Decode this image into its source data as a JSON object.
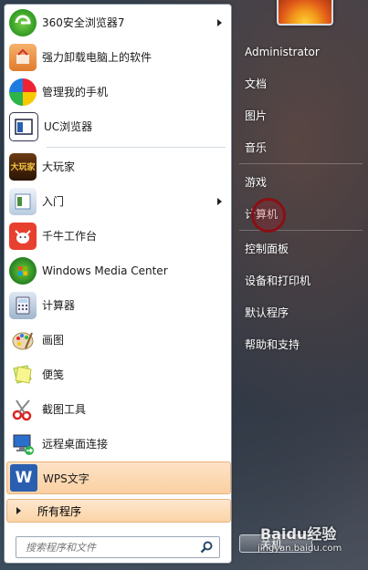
{
  "programs": [
    {
      "label": "360安全浏览器7",
      "icon": "360-browser-icon",
      "arrow": true
    },
    {
      "label": "强力卸载电脑上的软件",
      "icon": "uninstall-icon",
      "arrow": false
    },
    {
      "label": "管理我的手机",
      "icon": "phone-manager-icon",
      "arrow": false
    },
    {
      "label": "UC浏览器",
      "icon": "uc-browser-icon",
      "arrow": false
    },
    {
      "label": "大玩家",
      "icon": "game-player-icon",
      "arrow": false
    },
    {
      "label": "入门",
      "icon": "getting-started-icon",
      "arrow": true
    },
    {
      "label": "千牛工作台",
      "icon": "qianniu-icon",
      "arrow": false
    },
    {
      "label": "Windows Media Center",
      "icon": "media-center-icon",
      "arrow": false
    },
    {
      "label": "计算器",
      "icon": "calculator-icon",
      "arrow": false
    },
    {
      "label": "画图",
      "icon": "paint-icon",
      "arrow": false
    },
    {
      "label": "便笺",
      "icon": "sticky-notes-icon",
      "arrow": false
    },
    {
      "label": "截图工具",
      "icon": "snipping-tool-icon",
      "arrow": false
    },
    {
      "label": "远程桌面连接",
      "icon": "remote-desktop-icon",
      "arrow": false
    },
    {
      "label": "WPS文字",
      "icon": "wps-writer-icon",
      "arrow": false,
      "highlighted": true
    }
  ],
  "all_programs_label": "所有程序",
  "search": {
    "placeholder": "搜索程序和文件"
  },
  "right_items": [
    "Administrator",
    "文档",
    "图片",
    "音乐",
    "游戏",
    "计算机",
    "控制面板",
    "设备和打印机",
    "默认程序",
    "帮助和支持"
  ],
  "shutdown_label": "关机",
  "watermark": "Baidu经验",
  "watermark_url": "jingyan.baidu.com"
}
